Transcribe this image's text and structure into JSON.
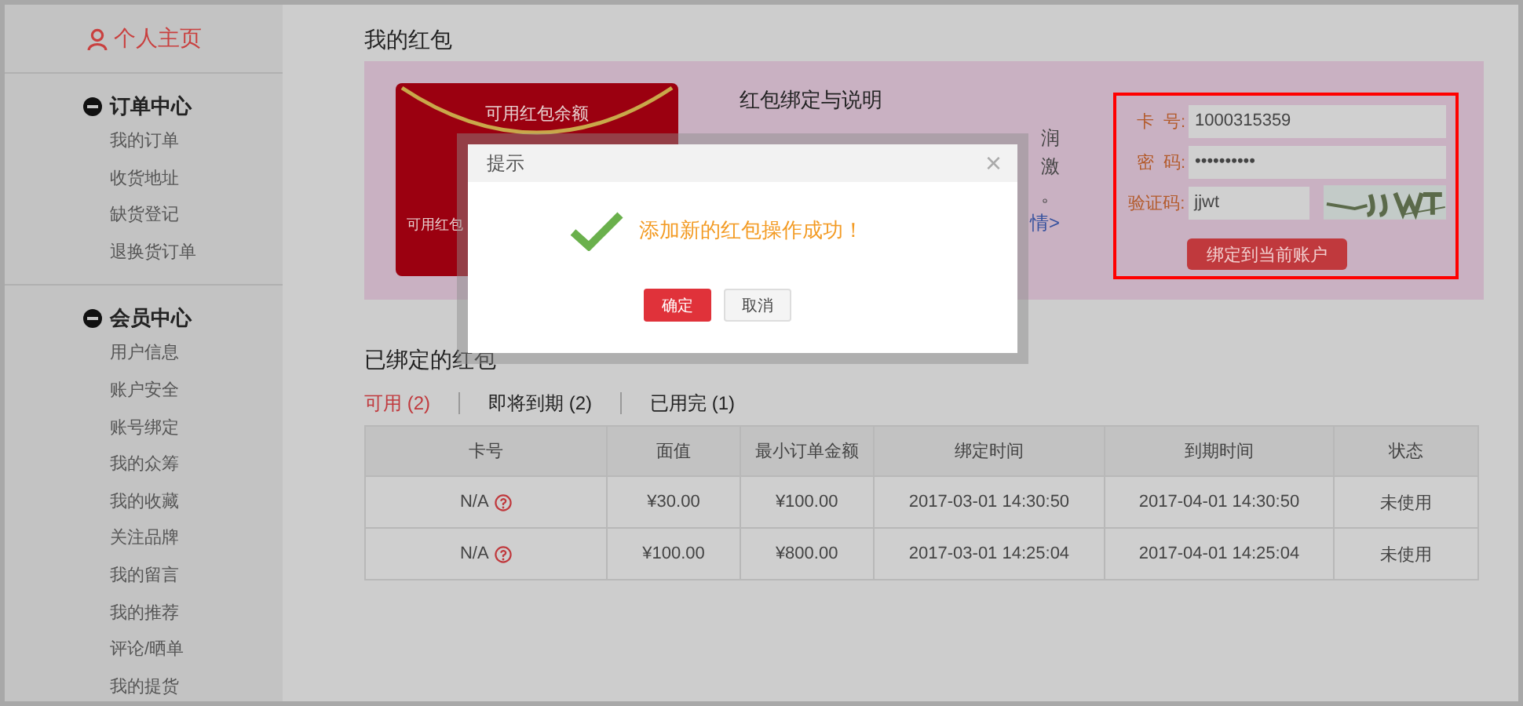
{
  "sidebar": {
    "home": {
      "label": "个人主页",
      "selected": true
    },
    "groups": [
      {
        "title": "订单中心",
        "expanded": true,
        "items": [
          "我的订单",
          "收货地址",
          "缺货登记",
          "退换货订单"
        ]
      },
      {
        "title": "会员中心",
        "expanded": true,
        "items": [
          "用户信息",
          "账户安全",
          "账号绑定",
          "我的众筹",
          "我的收藏",
          "关注品牌",
          "我的留言",
          "我的推荐",
          "评论/晒单",
          "我的提货"
        ]
      }
    ]
  },
  "wallet": {
    "title": "我的红包",
    "envelope": {
      "top_label": "可用红包余额",
      "bottom_label": "可用红包"
    },
    "info": {
      "title": "红包绑定与说明",
      "fragments": [
        {
          "kind": "text",
          "text": "润"
        },
        {
          "kind": "text",
          "text": "激"
        },
        {
          "kind": "text",
          "text": "。"
        },
        {
          "kind": "link",
          "text": "情>"
        }
      ]
    },
    "form": {
      "fields": [
        {
          "label": "卡  号:",
          "value": "1000315359",
          "kind": "text"
        },
        {
          "label": "密  码:",
          "value": "••••••••••",
          "kind": "password"
        },
        {
          "label": "验证码:",
          "value": "jjwt",
          "kind": "captcha"
        }
      ],
      "button": "绑定到当前账户"
    }
  },
  "bound": {
    "title": "已绑定的红包",
    "tabs": [
      {
        "label": "可用 (2)",
        "selected": true
      },
      {
        "label": "即将到期 (2)",
        "selected": false
      },
      {
        "label": "已用完 (1)",
        "selected": false
      }
    ],
    "columns": [
      "卡号",
      "面值",
      "最小订单金额",
      "绑定时间",
      "到期时间",
      "状态"
    ],
    "rows": [
      [
        "N/A",
        "¥30.00",
        "¥100.00",
        "2017-03-01 14:30:50",
        "2017-04-01 14:30:50",
        "未使用"
      ],
      [
        "N/A",
        "¥100.00",
        "¥800.00",
        "2017-03-01 14:25:04",
        "2017-04-01 14:25:04",
        "未使用"
      ]
    ]
  },
  "dialog": {
    "title": "提示",
    "close": "×",
    "message": "添加新的红包操作成功！",
    "buttons": [
      {
        "label": "确定",
        "kind": "primary"
      },
      {
        "label": "取消",
        "kind": "secondary"
      }
    ]
  }
}
